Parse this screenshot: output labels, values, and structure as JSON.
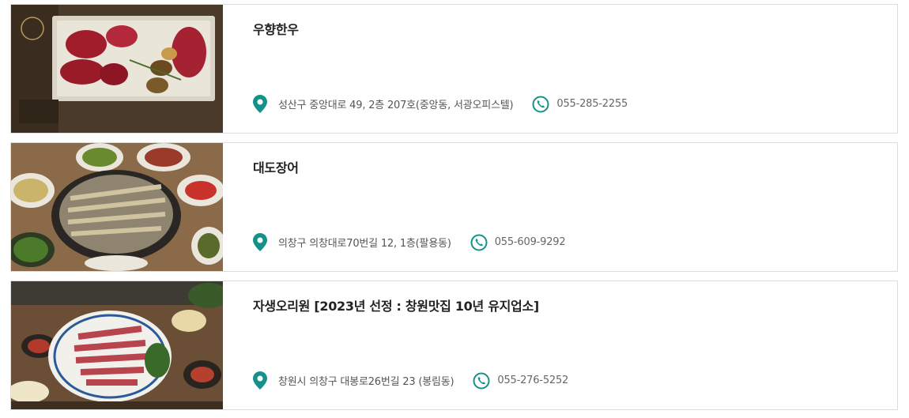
{
  "accent_color": "#14928a",
  "restaurants": [
    {
      "name": "우향한우",
      "address": "성산구 중앙대로 49, 2층 207호(중앙동, 서광오피스텔)",
      "phone": "055-285-2255",
      "photo": "raw-beef-platter-photo"
    },
    {
      "name": "대도장어",
      "address": "의창구 의창대로70번길 12, 1층(팔용동)",
      "phone": "055-609-9292",
      "photo": "grilled-eel-photo"
    },
    {
      "name": "자생오리원 [2023년 선정 : 창원맛집 10년 유지업소]",
      "address": "창원시 의창구 대봉로26번길 23 (봉림동)",
      "phone": "055-276-5252",
      "photo": "sliced-duck-platter-photo"
    }
  ]
}
